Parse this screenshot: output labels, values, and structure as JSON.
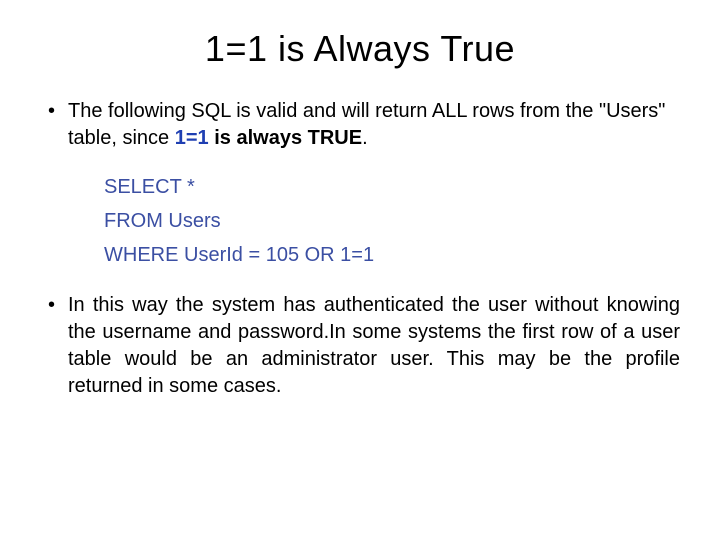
{
  "slide": {
    "title": "1=1 is Always True",
    "bullets": [
      {
        "pre": "The following SQL is valid and will return ALL rows from the \"Users\" table, since ",
        "emph1": "1=1",
        "mid": " ",
        "emph2": "is always TRUE",
        "post": "."
      },
      {
        "text": "In this way the system has authenticated the user without knowing the username and password.In some systems the first row of a user table would be an administrator user. This may be the profile returned in some cases."
      }
    ],
    "sql": {
      "line1": "SELECT *",
      "line2": "FROM Users",
      "line3": "WHERE UserId = 105 OR 1=1"
    }
  }
}
